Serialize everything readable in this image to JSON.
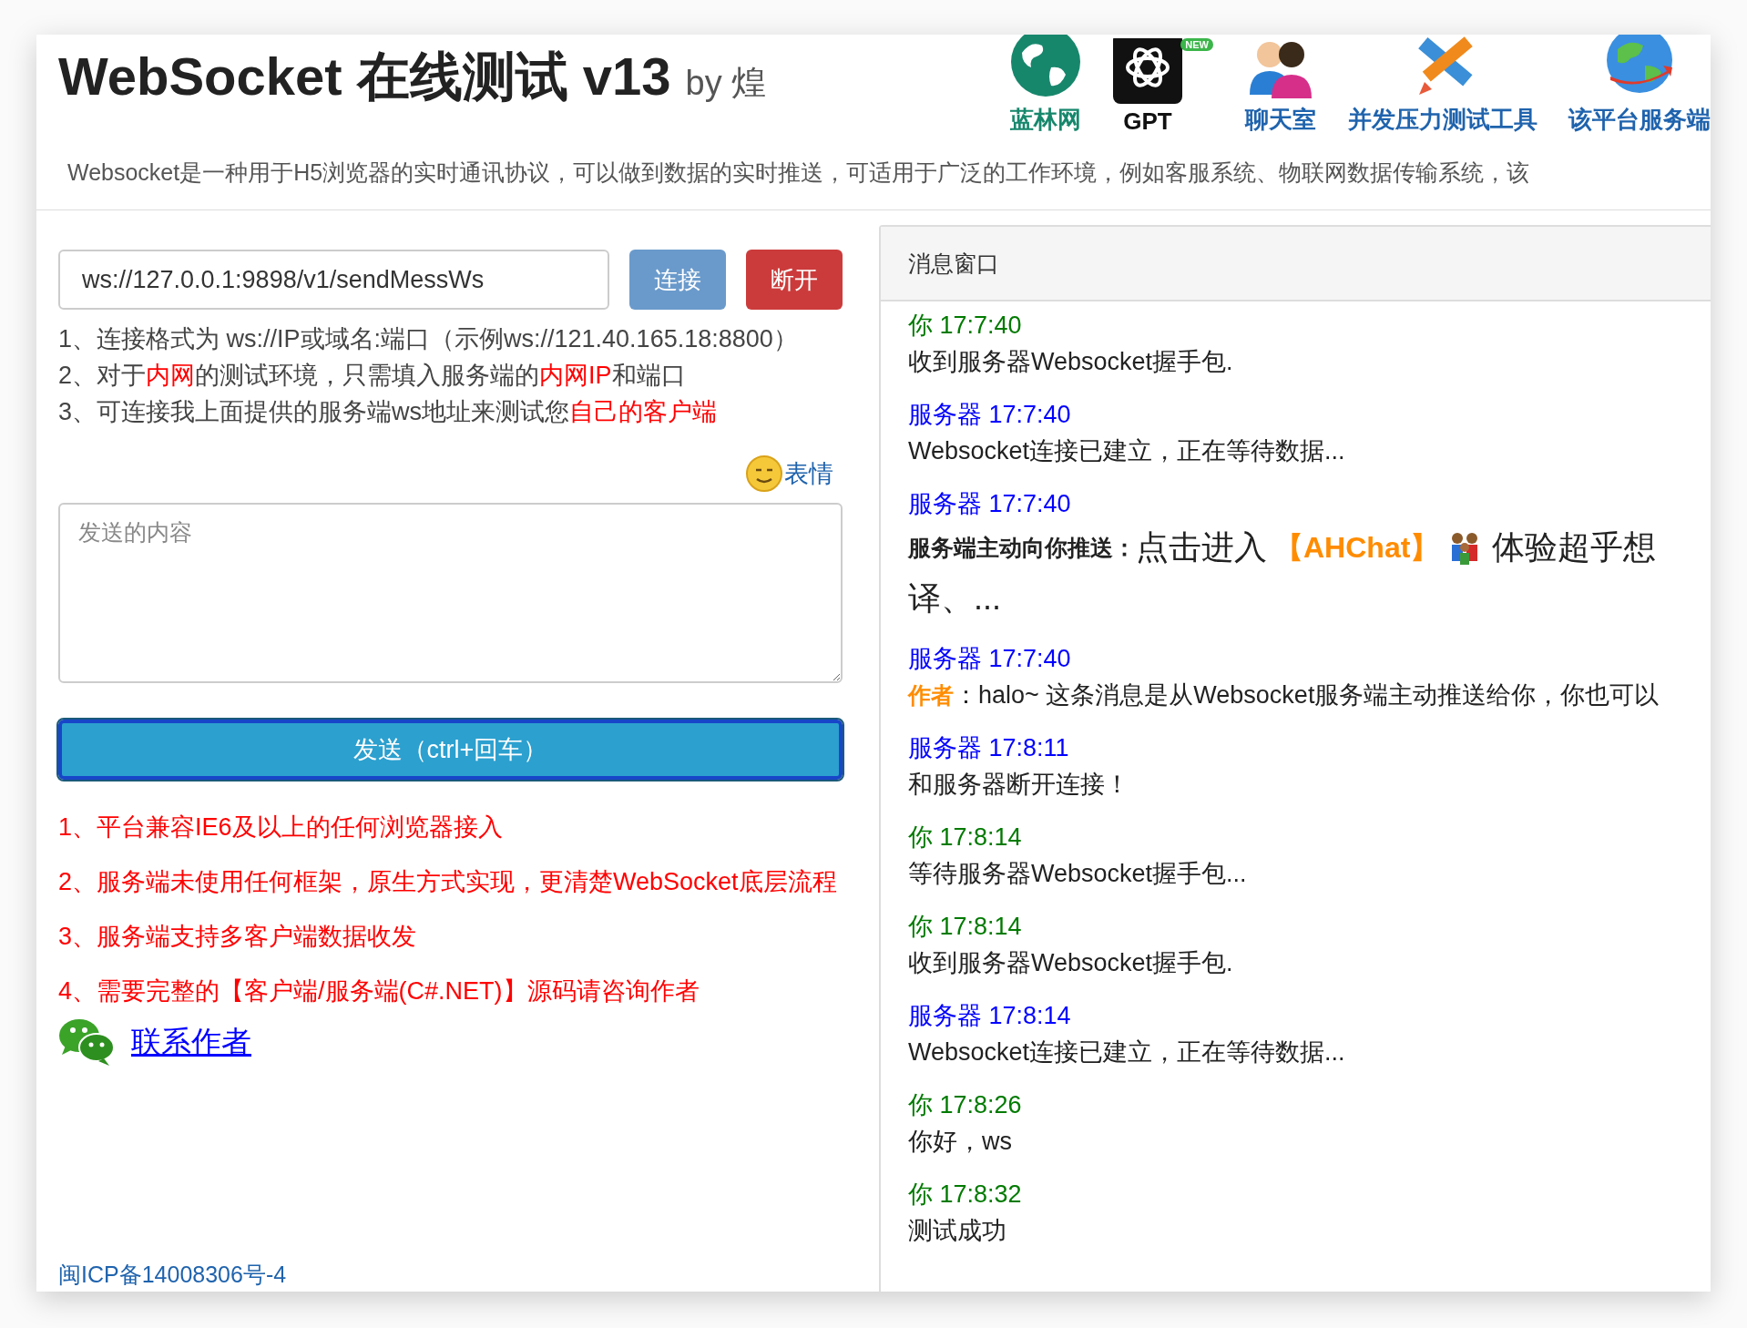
{
  "header": {
    "title": "WebSocket 在线测试 v13",
    "byline": "by 煌",
    "nav": [
      {
        "label": "蓝林网",
        "color": "#17876c"
      },
      {
        "label": "GPT",
        "color": "#111111",
        "badge": "NEW"
      },
      {
        "label": "聊天室",
        "color": "#1f63ad"
      },
      {
        "label": "并发压力测试工具",
        "color": "#1f63ad"
      },
      {
        "label": "该平台服务端",
        "color": "#1f63ad"
      }
    ],
    "description": "Websocket是一种用于H5浏览器的实时通讯协议，可以做到数据的实时推送，可适用于广泛的工作环境，例如客服系统、物联网数据传输系统，该"
  },
  "connect": {
    "url": "ws://127.0.0.1:9898/v1/sendMessWs",
    "connect_button": "连接",
    "disconnect_button": "断开"
  },
  "notes": [
    [
      {
        "text": "1、连接格式为 ws://IP或域名:端口（示例ws://121.40.165.18:8800）",
        "highlight": false
      }
    ],
    [
      {
        "text": "2、对于",
        "highlight": false
      },
      {
        "text": "内网",
        "highlight": true
      },
      {
        "text": "的测试环境，只需填入服务端的",
        "highlight": false
      },
      {
        "text": "内网IP",
        "highlight": true
      },
      {
        "text": "和端口",
        "highlight": false
      }
    ],
    [
      {
        "text": "3、可连接我上面提供的服务端ws地址来测试您",
        "highlight": false
      },
      {
        "text": "自己的客户端",
        "highlight": true
      }
    ]
  ],
  "emoji_link": "表情",
  "message_input": {
    "placeholder": "发送的内容"
  },
  "send_button": "发送（ctrl+回车）",
  "features": [
    "1、平台兼容IE6及以上的任何浏览器接入",
    "2、服务端未使用任何框架，原生方式实现，更清楚WebSocket底层流程",
    "3、服务端支持多客户端数据收发",
    "4、需要完整的【客户端/服务端(C#.NET)】源码请咨询作者"
  ],
  "contact_link": "联系作者",
  "icp": "闽ICP备14008306号-4",
  "message_panel": {
    "title": "消息窗口",
    "messages": [
      {
        "kind": "you",
        "header": "你 17:7:40",
        "body": "收到服务器Websocket握手包."
      },
      {
        "kind": "server",
        "header": "服务器 17:7:40",
        "body": "Websocket连接已建立，正在等待数据..."
      },
      {
        "kind": "server",
        "header": "服务器 17:7:40",
        "label": "服务端主动向你推送：",
        "lead": "点击进入",
        "tag": "【AHChat】",
        "tail": "体验超乎想",
        "next_line": "译、..."
      },
      {
        "kind": "server",
        "header": "服务器 17:7:40",
        "label": "作者",
        "body": "：halo~ 这条消息是从Websocket服务端主动推送给你，你也可以"
      },
      {
        "kind": "server",
        "header": "服务器 17:8:11",
        "body": "和服务器断开连接！"
      },
      {
        "kind": "you",
        "header": "你 17:8:14",
        "body": "等待服务器Websocket握手包..."
      },
      {
        "kind": "you",
        "header": "你 17:8:14",
        "body": "收到服务器Websocket握手包."
      },
      {
        "kind": "server",
        "header": "服务器 17:8:14",
        "body": "Websocket连接已建立，正在等待数据..."
      },
      {
        "kind": "you",
        "header": "你 17:8:26",
        "body": "你好，ws"
      },
      {
        "kind": "you",
        "header": "你 17:8:32",
        "body": "测试成功"
      }
    ]
  }
}
